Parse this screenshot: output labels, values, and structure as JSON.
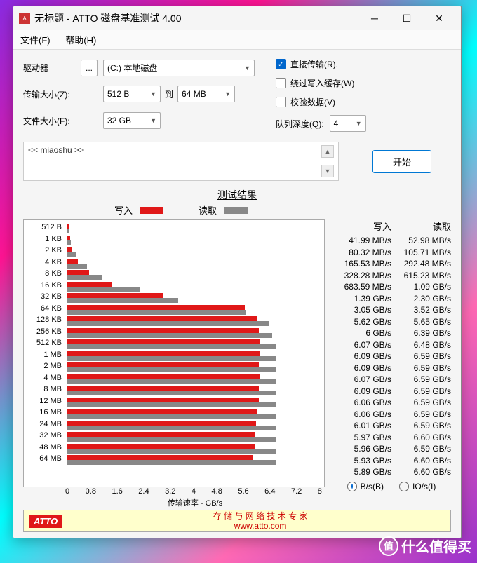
{
  "title": "无标题 - ATTO 磁盘基准测试 4.00",
  "menu": {
    "file": "文件(F)",
    "help": "帮助(H)"
  },
  "form": {
    "drive_label": "驱动器",
    "browse": "...",
    "drive_value": "(C:) 本地磁盘",
    "xfer_size_label": "传输大小(Z):",
    "xfer_from": "512 B",
    "to": "到",
    "xfer_to": "64 MB",
    "file_size_label": "文件大小(F):",
    "file_size": "32 GB"
  },
  "checks": {
    "direct": {
      "label": "直接传输(R).",
      "checked": true
    },
    "bypass": {
      "label": "绕过写入缓存(W)",
      "checked": false
    },
    "verify": {
      "label": "校验数据(V)",
      "checked": false
    },
    "queue_label": "队列深度(Q):",
    "queue_value": "4"
  },
  "desc_placeholder": "<< miaoshu >>",
  "start": "开始",
  "results_title": "测试结果",
  "legend": {
    "write": "写入",
    "read": "读取"
  },
  "table_head": {
    "write": "写入",
    "read": "读取"
  },
  "xlabel": "传输速率 - GB/s",
  "xticks": [
    "0",
    "0.8",
    "1.6",
    "2.4",
    "3.2",
    "4",
    "4.8",
    "5.6",
    "6.4",
    "7.2",
    "8"
  ],
  "radio": {
    "bs": "B/s(B)",
    "ios": "IO/s(I)"
  },
  "footer": {
    "atto": "ATTO",
    "line1": "存 储 与 网 络 技 术 专 家",
    "line2": "www.atto.com"
  },
  "watermark": "什么值得买",
  "chart_data": {
    "type": "bar",
    "orientation": "horizontal",
    "xlabel": "传输速率 - GB/s",
    "xlim": [
      0,
      8
    ],
    "max_gbps": 8,
    "series_names": [
      "写入",
      "读取"
    ],
    "rows": [
      {
        "size": "512 B",
        "write": "41.99 MB/s",
        "read": "52.98 MB/s",
        "w_gbps": 0.042,
        "r_gbps": 0.053
      },
      {
        "size": "1 KB",
        "write": "80.32 MB/s",
        "read": "105.71 MB/s",
        "w_gbps": 0.08,
        "r_gbps": 0.106
      },
      {
        "size": "2 KB",
        "write": "165.53 MB/s",
        "read": "292.48 MB/s",
        "w_gbps": 0.166,
        "r_gbps": 0.292
      },
      {
        "size": "4 KB",
        "write": "328.28 MB/s",
        "read": "615.23 MB/s",
        "w_gbps": 0.328,
        "r_gbps": 0.615
      },
      {
        "size": "8 KB",
        "write": "683.59 MB/s",
        "read": "1.09 GB/s",
        "w_gbps": 0.684,
        "r_gbps": 1.09
      },
      {
        "size": "16 KB",
        "write": "1.39 GB/s",
        "read": "2.30 GB/s",
        "w_gbps": 1.39,
        "r_gbps": 2.3
      },
      {
        "size": "32 KB",
        "write": "3.05 GB/s",
        "read": "3.52 GB/s",
        "w_gbps": 3.05,
        "r_gbps": 3.52
      },
      {
        "size": "64 KB",
        "write": "5.62 GB/s",
        "read": "5.65 GB/s",
        "w_gbps": 5.62,
        "r_gbps": 5.65
      },
      {
        "size": "128 KB",
        "write": "6 GB/s",
        "read": "6.39 GB/s",
        "w_gbps": 6.0,
        "r_gbps": 6.39
      },
      {
        "size": "256 KB",
        "write": "6.07 GB/s",
        "read": "6.48 GB/s",
        "w_gbps": 6.07,
        "r_gbps": 6.48
      },
      {
        "size": "512 KB",
        "write": "6.09 GB/s",
        "read": "6.59 GB/s",
        "w_gbps": 6.09,
        "r_gbps": 6.59
      },
      {
        "size": "1 MB",
        "write": "6.09 GB/s",
        "read": "6.59 GB/s",
        "w_gbps": 6.09,
        "r_gbps": 6.59
      },
      {
        "size": "2 MB",
        "write": "6.07 GB/s",
        "read": "6.59 GB/s",
        "w_gbps": 6.07,
        "r_gbps": 6.59
      },
      {
        "size": "4 MB",
        "write": "6.09 GB/s",
        "read": "6.59 GB/s",
        "w_gbps": 6.09,
        "r_gbps": 6.59
      },
      {
        "size": "8 MB",
        "write": "6.06 GB/s",
        "read": "6.59 GB/s",
        "w_gbps": 6.06,
        "r_gbps": 6.59
      },
      {
        "size": "12 MB",
        "write": "6.06 GB/s",
        "read": "6.59 GB/s",
        "w_gbps": 6.06,
        "r_gbps": 6.59
      },
      {
        "size": "16 MB",
        "write": "6.01 GB/s",
        "read": "6.59 GB/s",
        "w_gbps": 6.01,
        "r_gbps": 6.59
      },
      {
        "size": "24 MB",
        "write": "5.97 GB/s",
        "read": "6.60 GB/s",
        "w_gbps": 5.97,
        "r_gbps": 6.6
      },
      {
        "size": "32 MB",
        "write": "5.96 GB/s",
        "read": "6.59 GB/s",
        "w_gbps": 5.96,
        "r_gbps": 6.59
      },
      {
        "size": "48 MB",
        "write": "5.93 GB/s",
        "read": "6.60 GB/s",
        "w_gbps": 5.93,
        "r_gbps": 6.6
      },
      {
        "size": "64 MB",
        "write": "5.89 GB/s",
        "read": "6.60 GB/s",
        "w_gbps": 5.89,
        "r_gbps": 6.6
      }
    ]
  }
}
